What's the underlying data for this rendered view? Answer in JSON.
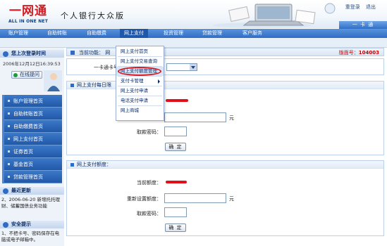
{
  "header": {
    "logo_text": "一网通",
    "logo_sub": "ALL IN ONE NET",
    "slogan": "个人银行大众版",
    "links": [
      "重登录",
      "退出"
    ],
    "card_tab": "一 卡 通"
  },
  "nav": {
    "items": [
      "账户管理",
      "自助转账",
      "自助缴费",
      "网上支付",
      "投资管理",
      "贷款管理",
      "客户服务"
    ],
    "active_index": 3
  },
  "sidebar": {
    "login_title": "您上次登录时间",
    "login_time": "2006年12月12日16:39:53",
    "help_label": "在线提问",
    "menu": [
      "账户管理首页",
      "自助转账首页",
      "自助缴费首页",
      "网上支付首页",
      "证券首页",
      "基金首页",
      "贷款管理首页"
    ],
    "news_title": "最近更新",
    "news_text": "2、2006-06-20  新增托托理财、储蓄国债业务功能",
    "security_title": "安全提示",
    "security_text": "1、不把卡号、密码保存在电脑或电子邮箱中。"
  },
  "main": {
    "func_label": "当前功能：  网",
    "version_label": "版面号：",
    "version_number": "104003",
    "card_label": "一卡通卡号：",
    "section1_title": "网上支付每日限",
    "yuan": "元",
    "password_label": "取款密码：",
    "ok_label": "确 定",
    "section2_title": "网上支付额度：",
    "current_limit_label": "当前额度：",
    "reset_limit_label": "重新设置额度：",
    "password_label2": "取款密码：",
    "ok_label2": "确 定"
  },
  "dropdown": {
    "items": [
      "网上支付首页",
      "网上支付交易查询",
      "网上支付额度管理",
      "支付卡管理",
      "网上支付申请",
      "电话支付申请",
      "网上商城"
    ],
    "selected_index": 2
  },
  "colors": {
    "nav_blue": "#2f6cc4",
    "brand_red": "#d71920",
    "highlight_red": "#d81b23"
  }
}
